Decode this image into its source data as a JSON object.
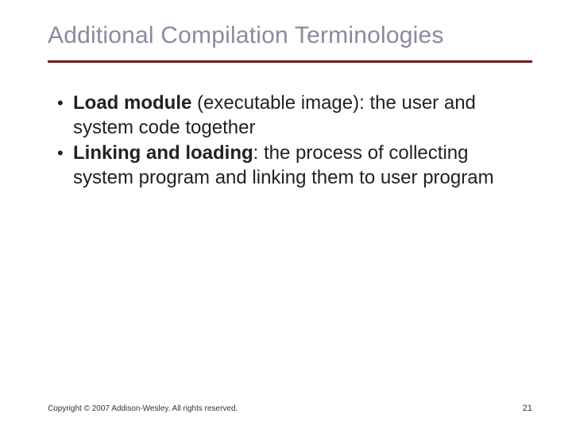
{
  "title": "Additional Compilation Terminologies",
  "bullets": [
    {
      "term": "Load module",
      "rest": " (executable image): the user and system code together"
    },
    {
      "term": "Linking and loading",
      "rest": ": the process of collecting system program and linking them to user program"
    }
  ],
  "footer": {
    "copyright": "Copyright © 2007 Addison-Wesley. All rights reserved.",
    "page": "21"
  }
}
